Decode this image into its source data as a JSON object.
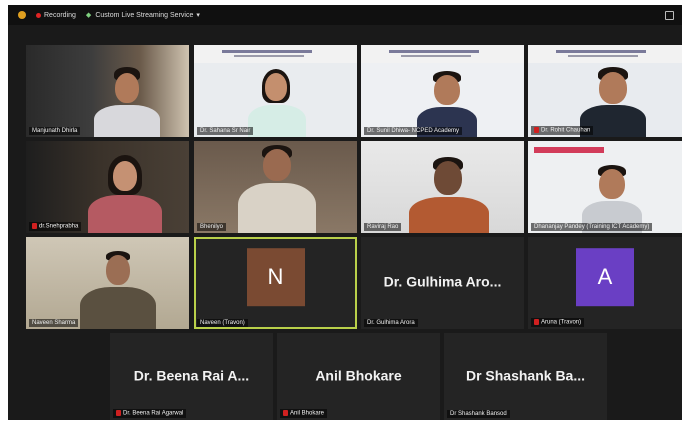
{
  "toolbar": {
    "recording_label": "Recording",
    "service_label": "Custom Live Streaming Service"
  },
  "tiles": [
    {
      "name": "Manjunath Dhirla"
    },
    {
      "name": "Dr. Sahana Sr Nair"
    },
    {
      "name": "Dr. Sunil Dhiwa- NCPED Academy"
    },
    {
      "name": "Dr. Rohit Chauhan"
    },
    {
      "name": "dr.Snehprabha"
    },
    {
      "name": "Bhenilyo"
    },
    {
      "name": "Raviraj Rao"
    },
    {
      "name": "Dhananjay Pandey (Training ICT Academy)"
    },
    {
      "name": "Naveen Sharma"
    },
    {
      "name": "Naveen (Travon)",
      "avatar_letter": "N",
      "avatar_color": "#7a4a32"
    },
    {
      "name": "Dr. Gulhima Arora",
      "display_name": "Dr. Gulhima Aro..."
    },
    {
      "name": "Aruna (Travon)",
      "avatar_letter": "A",
      "avatar_color": "#6a3fc4"
    },
    {
      "name": "Dr. Beena Rai Agarwal",
      "display_name": "Dr. Beena Rai A..."
    },
    {
      "name": "Anil Bhokare",
      "display_name": "Anil Bhokare"
    },
    {
      "name": "Dr Shashank Bansod",
      "display_name": "Dr Shashank Ba..."
    }
  ],
  "colors": {
    "active_speaker_outline": "#b9d04a",
    "muted_icon": "#d02020"
  }
}
